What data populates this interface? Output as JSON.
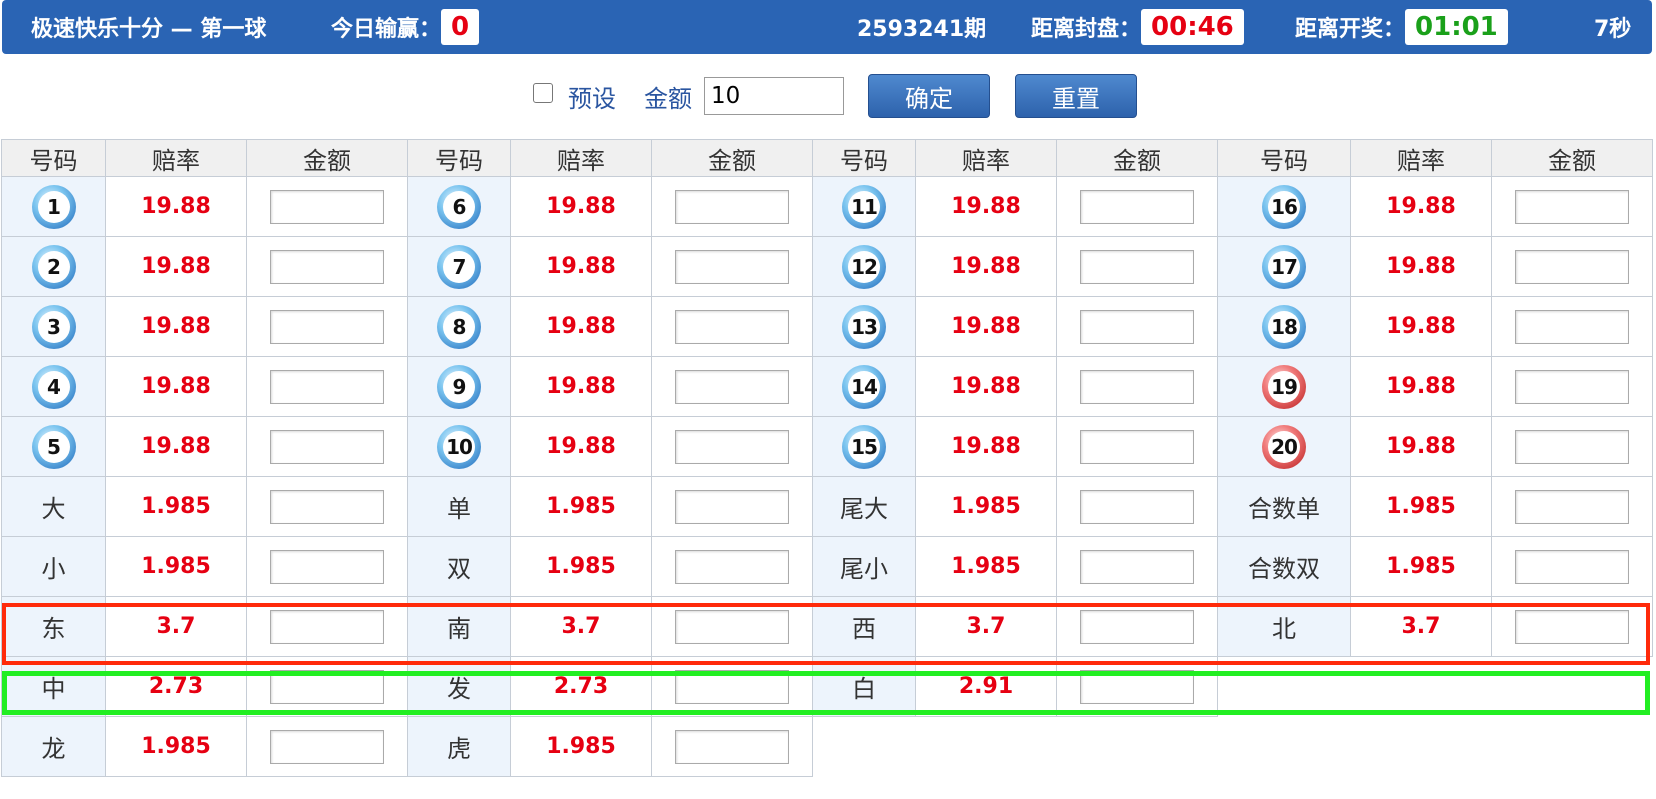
{
  "header": {
    "game_title": "极速快乐十分 — 第一球",
    "today_pl_label": "今日输赢：",
    "today_pl_value": "0",
    "period": "2593241期",
    "close_label": "距离封盘：",
    "close_time": "00:46",
    "draw_label": "距离开奖：",
    "draw_time": "01:01",
    "refresh": "7秒"
  },
  "controls": {
    "preset_label": "预设",
    "amount_label": "金额",
    "amount_value": "10",
    "confirm_label": "确定",
    "reset_label": "重置"
  },
  "table": {
    "headers": [
      "号码",
      "赔率",
      "金额"
    ],
    "number_rows": [
      [
        {
          "n": "1",
          "odds": "19.88"
        },
        {
          "n": "6",
          "odds": "19.88"
        },
        {
          "n": "11",
          "odds": "19.88"
        },
        {
          "n": "16",
          "odds": "19.88"
        }
      ],
      [
        {
          "n": "2",
          "odds": "19.88"
        },
        {
          "n": "7",
          "odds": "19.88"
        },
        {
          "n": "12",
          "odds": "19.88"
        },
        {
          "n": "17",
          "odds": "19.88"
        }
      ],
      [
        {
          "n": "3",
          "odds": "19.88"
        },
        {
          "n": "8",
          "odds": "19.88"
        },
        {
          "n": "13",
          "odds": "19.88"
        },
        {
          "n": "18",
          "odds": "19.88"
        }
      ],
      [
        {
          "n": "4",
          "odds": "19.88"
        },
        {
          "n": "9",
          "odds": "19.88"
        },
        {
          "n": "14",
          "odds": "19.88"
        },
        {
          "n": "19",
          "odds": "19.88",
          "color": "red"
        }
      ],
      [
        {
          "n": "5",
          "odds": "19.88"
        },
        {
          "n": "10",
          "odds": "19.88"
        },
        {
          "n": "15",
          "odds": "19.88"
        },
        {
          "n": "20",
          "odds": "19.88",
          "color": "red"
        }
      ]
    ],
    "text_rows": [
      [
        {
          "label": "大",
          "odds": "1.985"
        },
        {
          "label": "单",
          "odds": "1.985"
        },
        {
          "label": "尾大",
          "odds": "1.985"
        },
        {
          "label": "合数单",
          "odds": "1.985"
        }
      ],
      [
        {
          "label": "小",
          "odds": "1.985"
        },
        {
          "label": "双",
          "odds": "1.985"
        },
        {
          "label": "尾小",
          "odds": "1.985"
        },
        {
          "label": "合数双",
          "odds": "1.985"
        }
      ],
      [
        {
          "label": "东",
          "odds": "3.7"
        },
        {
          "label": "南",
          "odds": "3.7"
        },
        {
          "label": "西",
          "odds": "3.7"
        },
        {
          "label": "北",
          "odds": "3.7"
        }
      ],
      [
        {
          "label": "中",
          "odds": "2.73"
        },
        {
          "label": "发",
          "odds": "2.73"
        },
        {
          "label": "白",
          "odds": "2.91"
        }
      ],
      [
        {
          "label": "龙",
          "odds": "1.985"
        },
        {
          "label": "虎",
          "odds": "1.985"
        }
      ]
    ]
  },
  "colors": {
    "header_bg": "#2a64b4",
    "odds_red": "#e60012",
    "draw_green": "#1aa01a",
    "highlight_red": "#ff2a0a",
    "highlight_green": "#22ee22"
  }
}
